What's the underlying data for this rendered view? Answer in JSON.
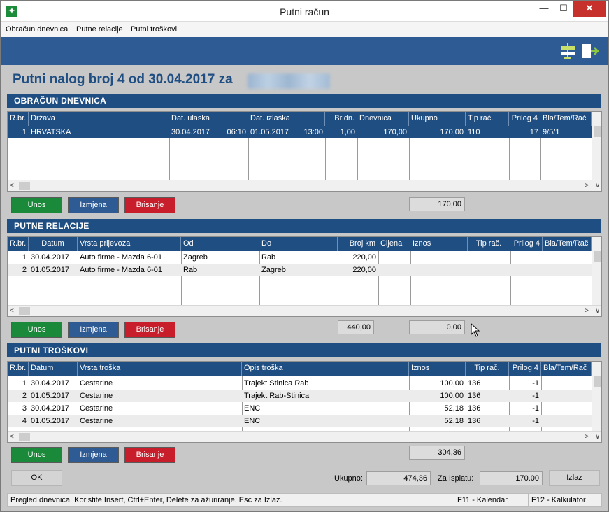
{
  "window": {
    "title": "Putni račun",
    "app_icon": "✦",
    "min": "—",
    "max": "☐",
    "close": "✕"
  },
  "menu": [
    "Obračun dnevnica",
    "Putne relacije",
    "Putni troškovi"
  ],
  "toolbar": {
    "icons": [
      "signpost-icon",
      "exit-icon"
    ]
  },
  "page_title": "Putni nalog broj 4 od 30.04.2017 za",
  "dnevnice": {
    "title": "OBRAČUN DNEVNICA",
    "columns": [
      "R.br.",
      "Država",
      "Dat. ulaska",
      "Dat. izlaska",
      "Br.dn.",
      "Dnevnica",
      "Ukupno",
      "Tip rač.",
      "Prilog 4",
      "Bla/Tem/Rač"
    ],
    "rows": [
      [
        "1",
        "HRVATSKA",
        "30.04.2017",
        "06:10",
        "01.05.2017",
        "13:00",
        "1,00",
        "170,00",
        "170,00",
        "110",
        "17",
        "9/5/1"
      ]
    ],
    "total": "170,00"
  },
  "relacije": {
    "title": "PUTNE RELACIJE",
    "columns": [
      "R.br.",
      "Datum",
      "Vrsta prijevoza",
      "Od",
      "Do",
      "Broj km",
      "Cijena",
      "Iznos",
      "Tip rač.",
      "Prilog 4",
      "Bla/Tem/Rač"
    ],
    "rows": [
      [
        "1",
        "30.04.2017",
        "Auto firme - Mazda 6-01",
        "Zagreb",
        "Rab",
        "220,00"
      ],
      [
        "2",
        "01.05.2017",
        "Auto firme - Mazda 6-01",
        "Rab",
        "Zagreb",
        "220,00"
      ]
    ],
    "total_km": "440,00",
    "total": "0,00"
  },
  "troskovi": {
    "title": "PUTNI TROŠKOVI",
    "columns": [
      "R.br.",
      "Datum",
      "Vrsta troška",
      "Opis troška",
      "Iznos",
      "Tip rač.",
      "Prilog 4",
      "Bla/Tem/Rač"
    ],
    "rows": [
      [
        "1",
        "30.04.2017",
        "Cestarine",
        "Trajekt Stinica Rab",
        "100,00",
        "136",
        "-1"
      ],
      [
        "2",
        "01.05.2017",
        "Cestarine",
        "Trajekt Rab-Stinica",
        "100,00",
        "136",
        "-1"
      ],
      [
        "3",
        "30.04.2017",
        "Cestarine",
        "ENC",
        "52,18",
        "136",
        "-1"
      ],
      [
        "4",
        "01.05.2017",
        "Cestarine",
        "ENC",
        "52,18",
        "136",
        "-1"
      ]
    ],
    "total": "304,36"
  },
  "buttons": {
    "unos": "Unos",
    "izmjena": "Izmjena",
    "brisanje": "Brisanje",
    "ok": "OK",
    "izlaz": "Izlaz"
  },
  "summary": {
    "ukupno_label": "Ukupno:",
    "ukupno": "474,36",
    "isplata_label": "Za Isplatu:",
    "isplata": "170.00"
  },
  "status": {
    "message": "Pregled dnevnica. Koristite Insert, Ctrl+Enter, Delete za ažuriranje. Esc za Izlaz.",
    "f11": "F11 - Kalendar",
    "f12": "F12 - Kalkulator"
  },
  "scroll": {
    "left": "<",
    "right": ">",
    "down": "∨"
  }
}
